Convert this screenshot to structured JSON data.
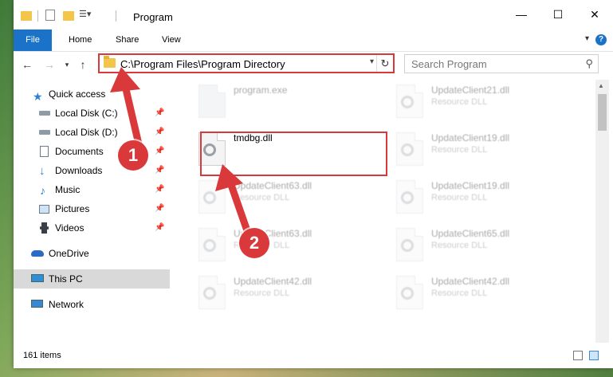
{
  "window": {
    "title": "Program",
    "controls": {
      "minimize": "—",
      "maximize": "☐",
      "close": "✕"
    }
  },
  "ribbon": {
    "tabs": [
      "File",
      "Home",
      "Share",
      "View"
    ],
    "help": "?"
  },
  "address_bar": {
    "path": "C:\\Program Files\\Program Directory",
    "search_placeholder": "Search Program"
  },
  "nav_pane": {
    "items": [
      {
        "label": "Quick access",
        "icon": "star-icon",
        "pinned": false
      },
      {
        "label": "Local Disk (C:)",
        "icon": "drive-icon",
        "pinned": true
      },
      {
        "label": "Local Disk (D:)",
        "icon": "drive-icon",
        "pinned": true
      },
      {
        "label": "Documents",
        "icon": "documents-icon",
        "pinned": true
      },
      {
        "label": "Downloads",
        "icon": "download-icon",
        "pinned": true
      },
      {
        "label": "Music",
        "icon": "music-icon",
        "pinned": true
      },
      {
        "label": "Pictures",
        "icon": "pictures-icon",
        "pinned": true
      },
      {
        "label": "Videos",
        "icon": "videos-icon",
        "pinned": true
      },
      {
        "label": "OneDrive",
        "icon": "cloud-icon",
        "pinned": false
      },
      {
        "label": "This PC",
        "icon": "computer-icon",
        "pinned": false,
        "selected": true
      },
      {
        "label": "Network",
        "icon": "network-icon",
        "pinned": false
      }
    ]
  },
  "files": [
    {
      "name": "program.exe",
      "type": ""
    },
    {
      "name": "UpdateClient21.dll",
      "type": "Resource DLL"
    },
    {
      "name": "tmdbg.dll",
      "type": ""
    },
    {
      "name": "UpdateClient19.dll",
      "type": "Resource DLL"
    },
    {
      "name": "UpdateClient63.dll",
      "type": "Resource DLL"
    },
    {
      "name": "UpdateClient19.dll",
      "type": "Resource DLL"
    },
    {
      "name": "UpdateClient63.dll",
      "type": "Resource DLL"
    },
    {
      "name": "UpdateClient65.dll",
      "type": "Resource DLL"
    },
    {
      "name": "UpdateClient42.dll",
      "type": "Resource DLL"
    },
    {
      "name": "UpdateClient42.dll",
      "type": "Resource DLL"
    }
  ],
  "callouts": [
    "1",
    "2"
  ],
  "status": {
    "item_count": "161 items"
  },
  "colors": {
    "accent": "#1a73c8",
    "highlight": "#d9393a",
    "selected_nav": "#d9d9d9"
  }
}
